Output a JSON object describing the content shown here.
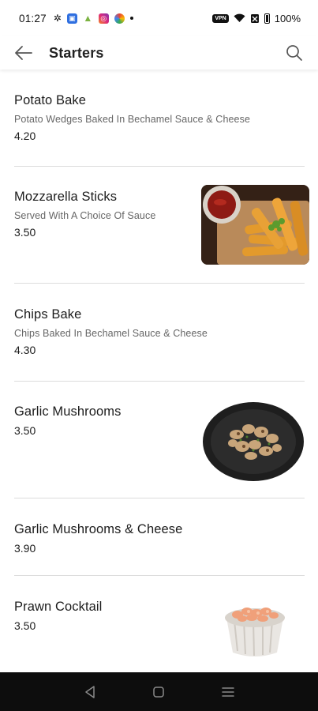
{
  "status_bar": {
    "time": "01:27",
    "vpn": "VPN",
    "battery": "100%"
  },
  "header": {
    "title": "Starters"
  },
  "items": [
    {
      "name": "Potato Bake",
      "description": "Potato Wedges Baked In Bechamel Sauce & Cheese",
      "price": "4.20"
    },
    {
      "name": "Mozzarella Sticks",
      "description": "Served With A Choice Of Sauce",
      "price": "3.50"
    },
    {
      "name": "Chips Bake",
      "description": "Chips Baked In Bechamel Sauce & Cheese",
      "price": "4.30"
    },
    {
      "name": "Garlic Mushrooms",
      "price": "3.50"
    },
    {
      "name": "Garlic Mushrooms & Cheese",
      "price": "3.90"
    },
    {
      "name": "Prawn Cocktail",
      "price": "3.50"
    }
  ],
  "colors": {
    "divider": "#dcdcdc",
    "nav_bar": "#0d0d0d",
    "secondary_text": "#666666"
  }
}
